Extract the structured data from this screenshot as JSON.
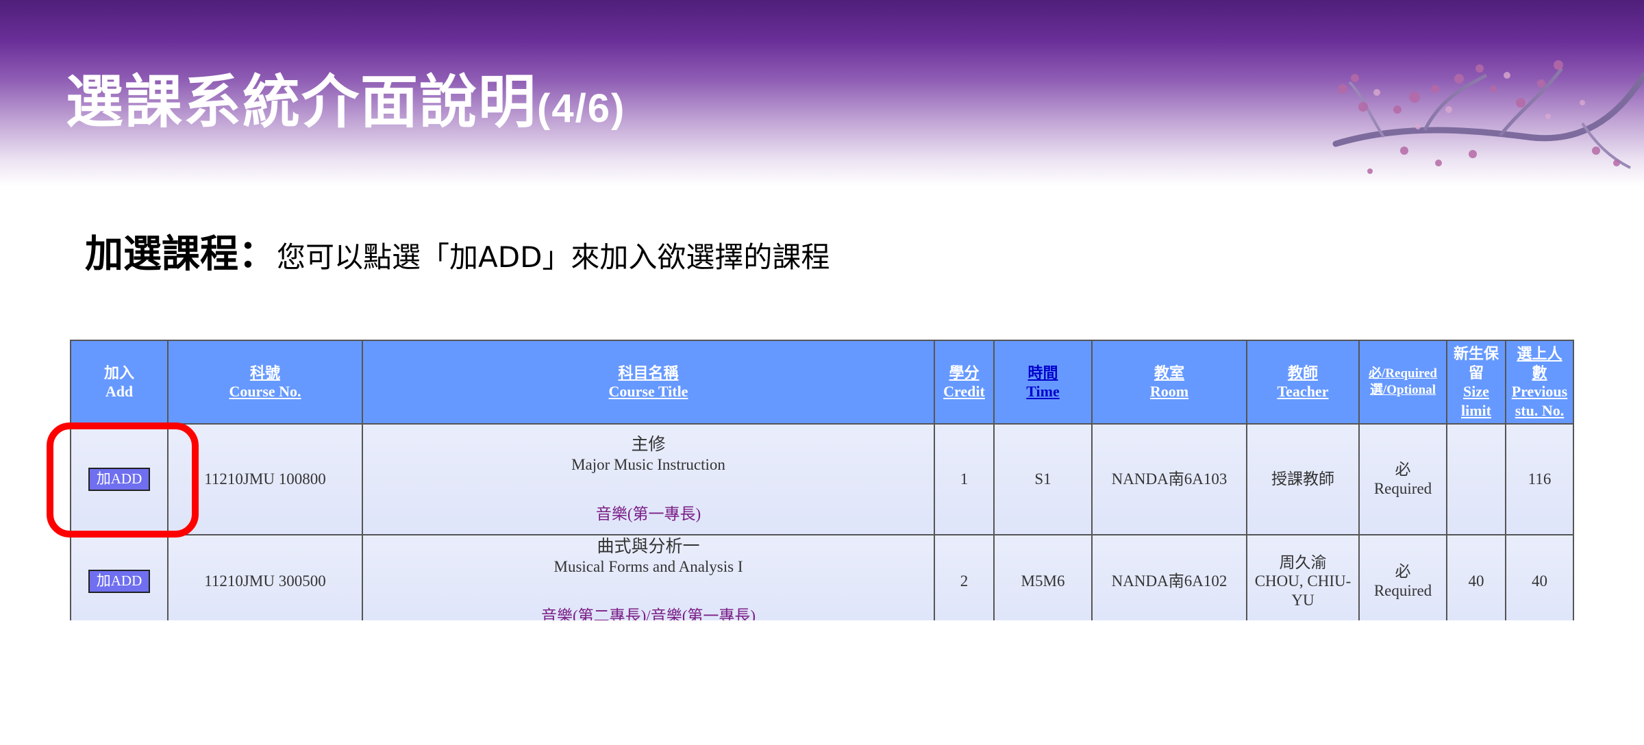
{
  "slide": {
    "title": "選課系統介面說明",
    "title_suffix": "(4/6)",
    "instruction_lead": "加選課程：",
    "instruction_body": "您可以點選「加ADD」來加入欲選擇的課程"
  },
  "colors": {
    "banner_dark": "#4f1f7a",
    "header_bg": "#6699ff",
    "row_bg": "#e4e9fb",
    "add_button": "#6f6ff0",
    "category_text": "#7a1f86",
    "highlight": "#ff0000"
  },
  "table": {
    "headers": {
      "add_zh": "加入",
      "add_en": "Add",
      "course_no_zh": "科號",
      "course_no_en": "Course No.",
      "title_zh": "科目名稱",
      "title_en": "Course Title",
      "credit_zh": "學分",
      "credit_en": "Credit",
      "time_zh": "時間",
      "time_en": "Time",
      "room_zh": "教室",
      "room_en": "Room",
      "teacher_zh": "教師",
      "teacher_en": "Teacher",
      "req_line1": "必/Required",
      "req_line2": "選/Optional",
      "size_zh1": "新生保",
      "size_zh2": "留",
      "size_en1": "Size",
      "size_en2": "limit",
      "prev_zh1": "選上人",
      "prev_zh2": "數",
      "prev_en1": "Previous",
      "prev_en2": "stu. No."
    },
    "rows": [
      {
        "add_label": "加ADD",
        "course_no": "11210JMU 100800",
        "title_zh": "主修",
        "title_en": "Major Music Instruction",
        "category": "音樂(第一專長)",
        "credit": "1",
        "time": "S1",
        "room": "NANDA南6A103",
        "teacher_zh": "授課教師",
        "teacher_en": "",
        "req_zh": "必",
        "req_en": "Required",
        "size_limit": "",
        "previous": "116"
      },
      {
        "add_label": "加ADD",
        "course_no": "11210JMU 300500",
        "title_zh": "曲式與分析一",
        "title_en": "Musical Forms and Analysis I",
        "category": "音樂(第二專長)/音樂(第一專長)",
        "credit": "2",
        "time": "M5M6",
        "room": "NANDA南6A102",
        "teacher_zh": "周久渝",
        "teacher_en": "CHOU, CHIU-YU",
        "req_zh": "必",
        "req_en": "Required",
        "size_limit": "40",
        "previous": "40"
      }
    ]
  }
}
